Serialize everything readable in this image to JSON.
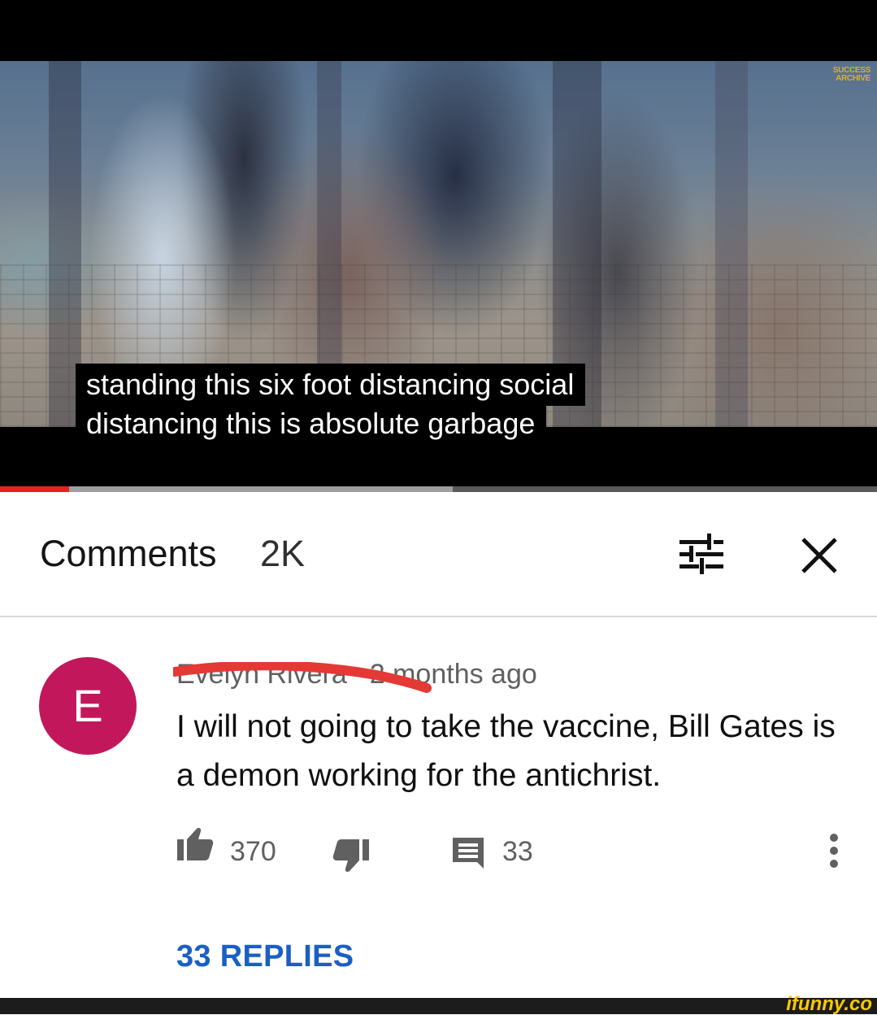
{
  "video": {
    "channel_logo": [
      "SUCCESS",
      "ARCHIVE"
    ],
    "caption_lines": [
      "standing this six foot distancing social",
      "distancing this is absolute garbage"
    ],
    "progress_played_fraction": 0.079,
    "progress_buffered_fraction": 0.516,
    "colors": {
      "played": "#e52222",
      "buffered": "#9e9e9e",
      "track": "#5a5a5a"
    }
  },
  "comments_header": {
    "title": "Comments",
    "count": "2K",
    "sort_icon": "sort-filter-icon",
    "close_icon": "close-icon"
  },
  "comment": {
    "avatar_letter": "E",
    "avatar_color": "#c2185b",
    "author": "Evelyn Rivera",
    "time": "2 months ago",
    "text": "I will not going to take the vaccine, Bill Gates is a demon working for the antichrist.",
    "likes": "370",
    "reply_count": "33",
    "replies_link": "33 REPLIES",
    "annotation_color": "#e53935"
  },
  "watermark": "ifunny.co"
}
